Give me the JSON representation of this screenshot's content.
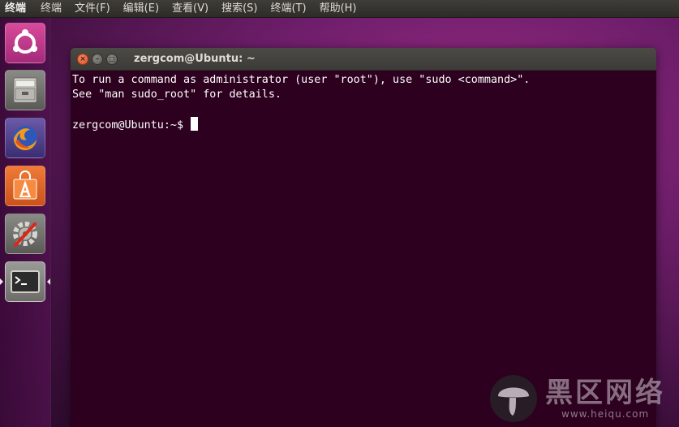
{
  "top_panel": {
    "app_title": "终端",
    "menu": [
      "终端",
      "文件(F)",
      "编辑(E)",
      "查看(V)",
      "搜索(S)",
      "终端(T)",
      "帮助(H)"
    ]
  },
  "launcher": {
    "items": [
      {
        "name": "ubuntu-dash-icon"
      },
      {
        "name": "files-icon"
      },
      {
        "name": "firefox-icon"
      },
      {
        "name": "software-center-icon"
      },
      {
        "name": "system-settings-icon"
      },
      {
        "name": "terminal-icon",
        "active": true
      }
    ]
  },
  "window": {
    "title": "zergcom@Ubuntu: ~",
    "close_glyph": "×",
    "min_glyph": "–",
    "max_glyph": "□"
  },
  "terminal": {
    "lines": [
      "To run a command as administrator (user \"root\"), use \"sudo <command>\".",
      "See \"man sudo_root\" for details.",
      "",
      "zergcom@Ubuntu:~$ "
    ]
  },
  "watermark": {
    "cn": "黑区网络",
    "url": "www.heiqu.com"
  },
  "colors": {
    "terminal_bg": "#2c001e",
    "terminal_fg": "#ffffff",
    "close_button": "#e1511f"
  }
}
